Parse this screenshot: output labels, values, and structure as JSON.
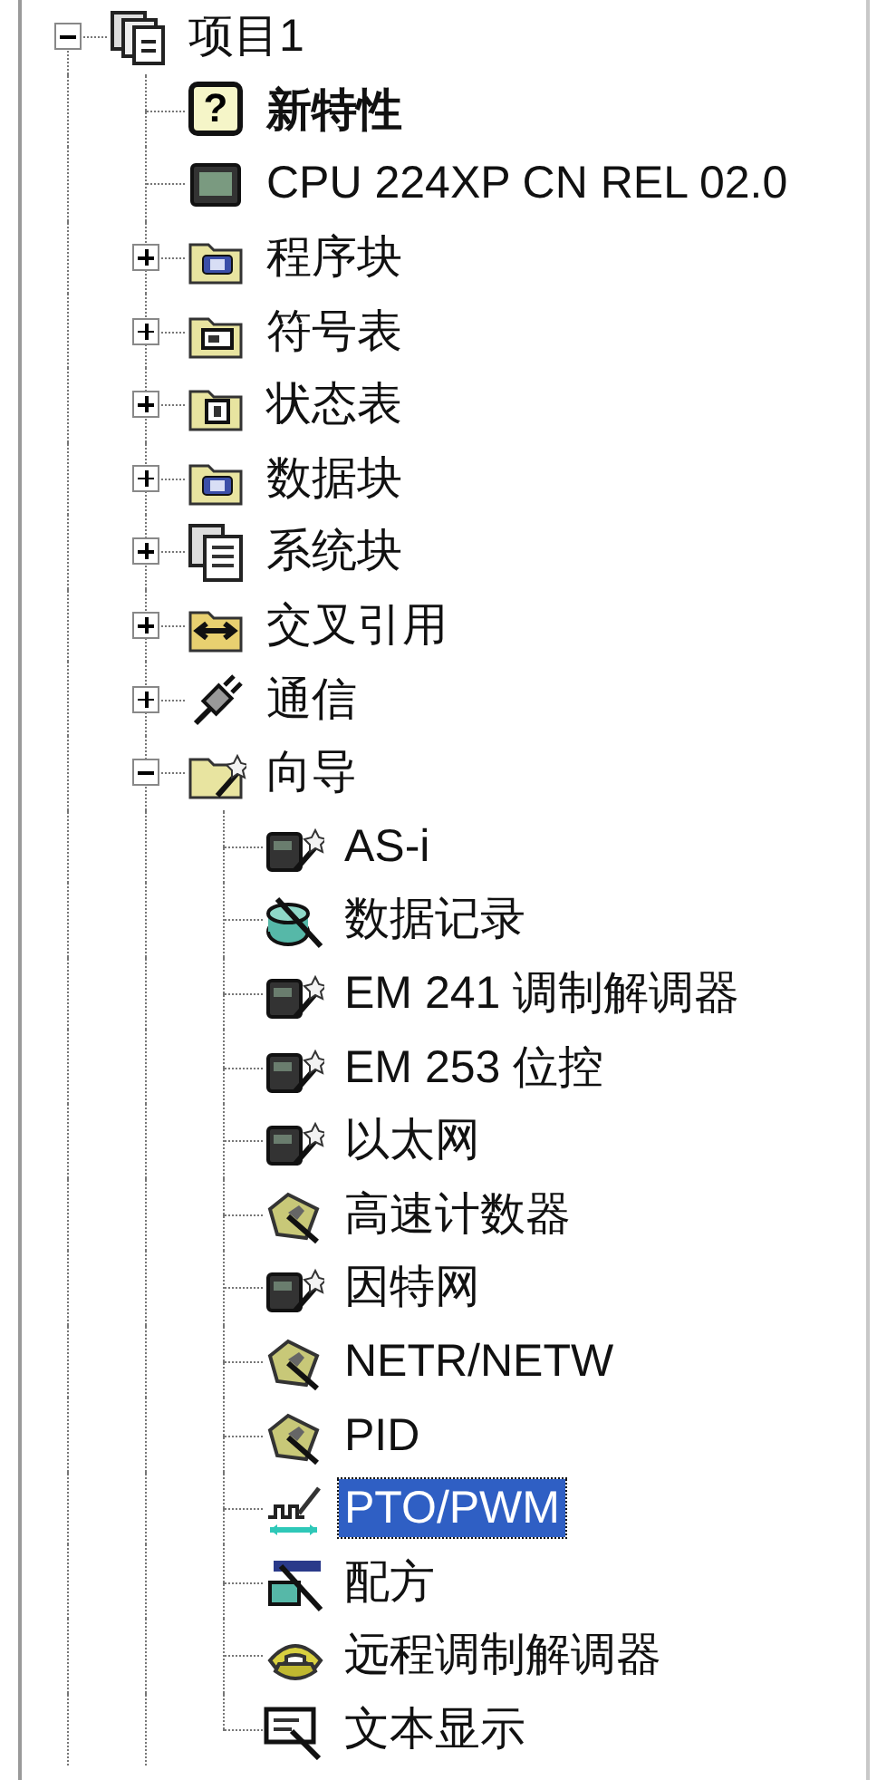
{
  "tree": [
    {
      "label": "项目1",
      "kind": "project",
      "expanded": true,
      "selected": false,
      "children": [
        {
          "label": "新特性",
          "kind": "help",
          "glyph": "?",
          "bold": true,
          "selected": false
        },
        {
          "label": "CPU 224XP CN REL 02.0",
          "kind": "cpu",
          "bold": false,
          "selected": false
        },
        {
          "label": "程序块",
          "kind": "program-folder",
          "expanded": false,
          "bold": false,
          "selected": false
        },
        {
          "label": "符号表",
          "kind": "symbol-folder",
          "expanded": false,
          "bold": false,
          "selected": false
        },
        {
          "label": "状态表",
          "kind": "status-folder",
          "expanded": false,
          "bold": false,
          "selected": false
        },
        {
          "label": "数据块",
          "kind": "program-folder",
          "expanded": false,
          "bold": false,
          "selected": false
        },
        {
          "label": "系统块",
          "kind": "system",
          "expanded": false,
          "bold": false,
          "selected": false
        },
        {
          "label": "交叉引用",
          "kind": "crossref",
          "expanded": false,
          "bold": false,
          "selected": false
        },
        {
          "label": "通信",
          "kind": "comm",
          "expanded": false,
          "bold": false,
          "selected": false
        },
        {
          "label": "向导",
          "kind": "wizard",
          "expanded": true,
          "bold": false,
          "selected": false,
          "children": [
            {
              "label": "AS-i",
              "kind": "module",
              "selected": false
            },
            {
              "label": "数据记录",
              "kind": "datalog",
              "selected": false
            },
            {
              "label": "EM 241 调制解调器",
              "kind": "module",
              "selected": false
            },
            {
              "label": "EM 253 位控",
              "kind": "module",
              "selected": false
            },
            {
              "label": "以太网",
              "kind": "module",
              "selected": false
            },
            {
              "label": "高速计数器",
              "kind": "hsc",
              "selected": false
            },
            {
              "label": "因特网",
              "kind": "module",
              "selected": false
            },
            {
              "label": "NETR/NETW",
              "kind": "hsc",
              "selected": false
            },
            {
              "label": "PID",
              "kind": "hsc",
              "selected": false
            },
            {
              "label": "PTO/PWM",
              "kind": "pulse",
              "selected": true
            },
            {
              "label": "配方",
              "kind": "recipe",
              "selected": false
            },
            {
              "label": "远程调制解调器",
              "kind": "modem",
              "selected": false
            },
            {
              "label": "文本显示",
              "kind": "display",
              "selected": false
            }
          ]
        }
      ]
    }
  ]
}
